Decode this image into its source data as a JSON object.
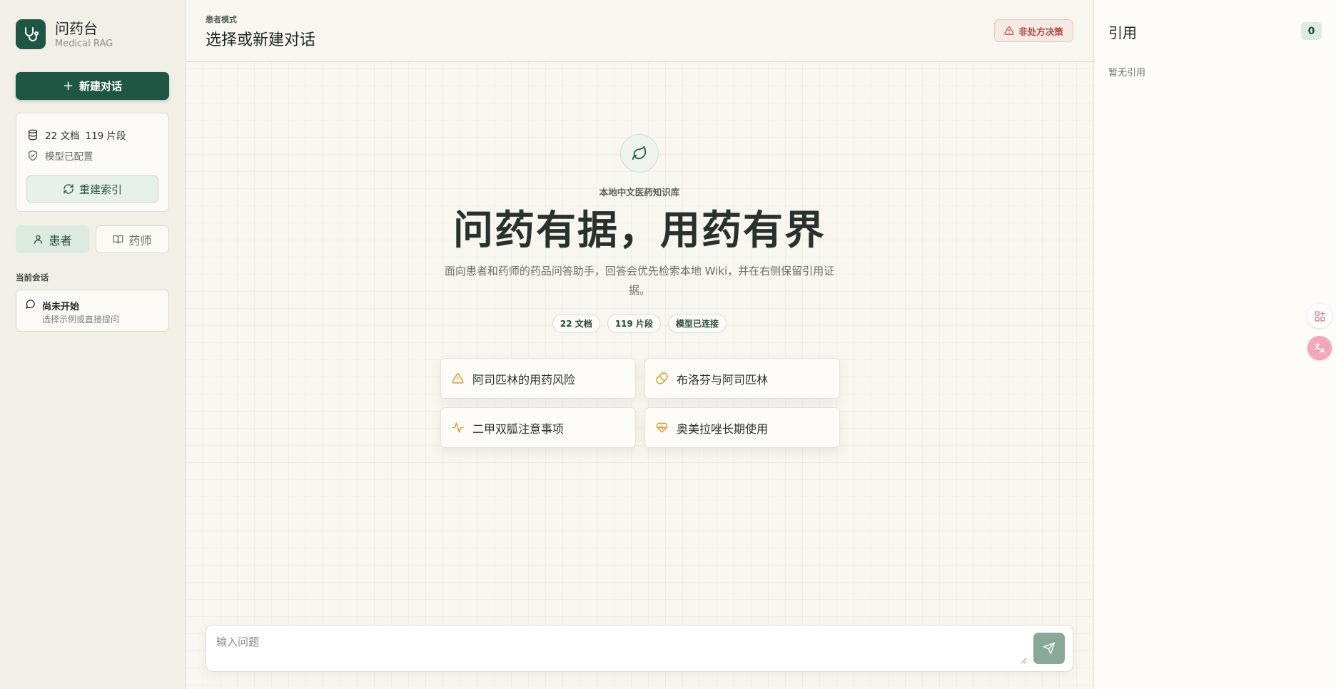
{
  "sidebar": {
    "brand_title": "问药台",
    "brand_sub": "Medical RAG",
    "new_chat_label": "新建对话",
    "stats": {
      "docs": "22 文档",
      "chunks": "119 片段",
      "model_status": "模型已配置"
    },
    "rebuild_label": "重建索引",
    "roles": {
      "patient": "患者",
      "pharmacist": "药师"
    },
    "current_session_label": "当前会话",
    "session": {
      "title": "尚未开始",
      "subtitle": "选择示例或直接提问"
    }
  },
  "header": {
    "mode_label": "患者模式",
    "title": "选择或新建对话",
    "warning_badge": "非处方决策"
  },
  "hero": {
    "kb_label": "本地中文医药知识库",
    "title": "问药有据，用药有界",
    "description": "面向患者和药师的药品问答助手，回答会优先检索本地 Wiki，并在右侧保留引用证据。",
    "pills": [
      "22 文档",
      "119 片段",
      "模型已连接"
    ]
  },
  "samples": [
    {
      "label": "阿司匹林的用药风险",
      "icon": "alert-triangle-icon"
    },
    {
      "label": "布洛芬与阿司匹林",
      "icon": "pill-icon"
    },
    {
      "label": "二甲双胍注意事项",
      "icon": "activity-icon"
    },
    {
      "label": "奥美拉唑长期使用",
      "icon": "heart-pulse-icon"
    }
  ],
  "composer": {
    "placeholder": "输入问题"
  },
  "refs": {
    "title": "引用",
    "count": "0",
    "empty": "暂无引用"
  },
  "colors": {
    "brand": "#1f5643",
    "warning": "#b2473a",
    "sample_icon": "#d49a2a"
  }
}
